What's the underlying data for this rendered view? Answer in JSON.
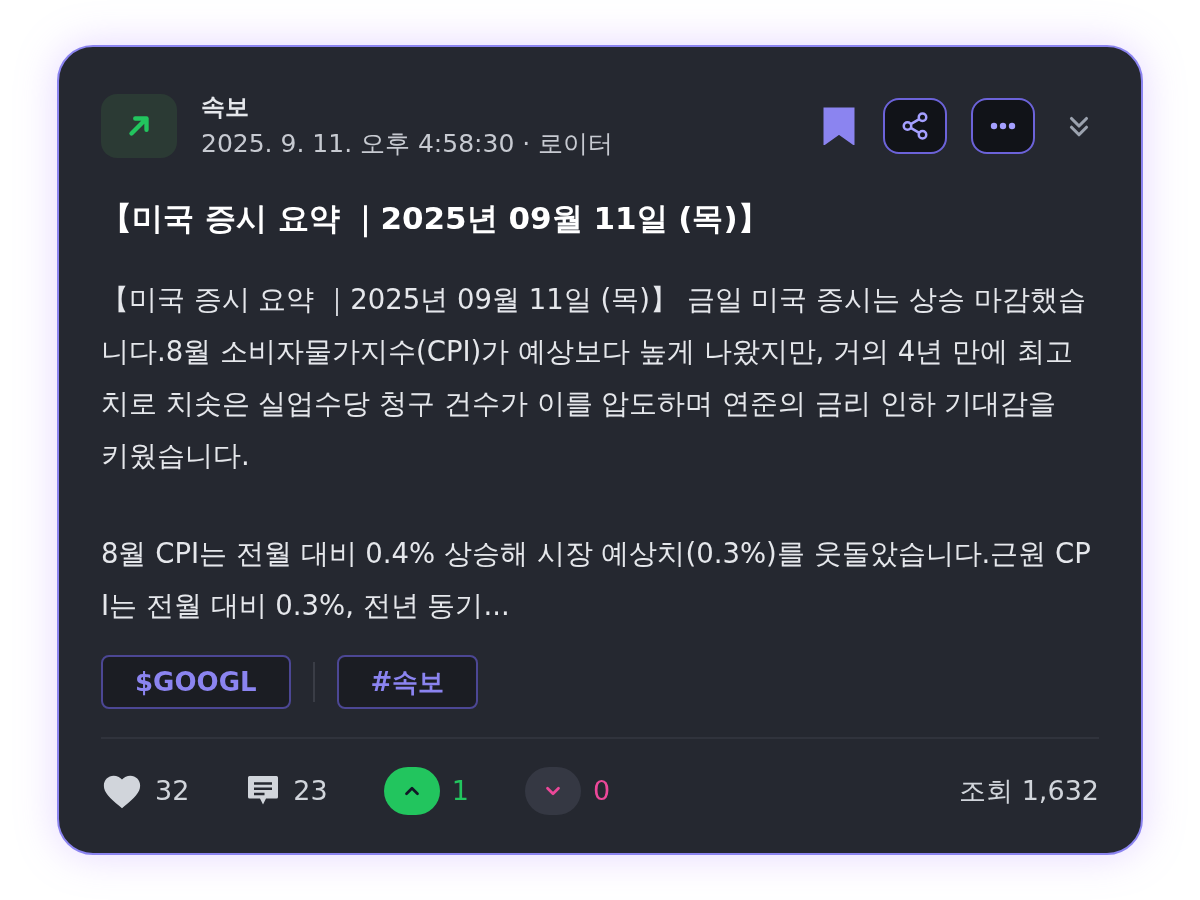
{
  "post": {
    "category": "속보",
    "meta": "2025. 9. 11. 오후 4:58:30 · 로이터",
    "bookmarked": true,
    "title": "【미국 증시 요약 ｜2025년 09월 11일 (목)】",
    "paragraphs": [
      "【미국 증시 요약 ｜2025년 09월 11일 (목)】 금일 미국 증시는 상승 마감했습니다.8월 소비자물가지수(CPI)가 예상보다 높게 나왔지만, 거의 4년 만에 최고치로 치솟은 실업수당 청구 건수가 이를 압도하며 연준의 금리 인하 기대감을 키웠습니다.",
      "8월 CPI는 전월 대비 0.4% 상승해 시장 예상치(0.3%)를 웃돌았습니다.근원 CPI는 전월 대비 0.3%, 전년 동기..."
    ],
    "tags": [
      "$GOOGL",
      "#속보"
    ],
    "likes": "32",
    "comments": "23",
    "upvote": {
      "count": "1",
      "selected": true
    },
    "downvote": {
      "count": "0",
      "selected": false
    },
    "views": "조회 1,632"
  }
}
